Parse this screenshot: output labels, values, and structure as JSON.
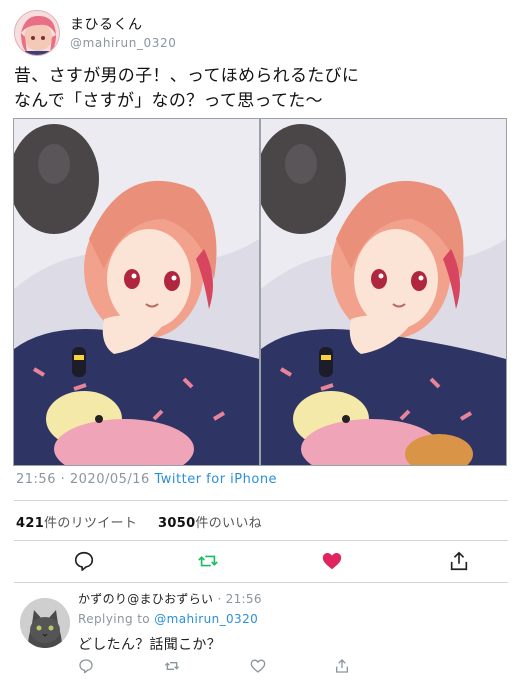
{
  "header": {
    "display_name": "まひるくん",
    "handle": "@mahirun_0320",
    "avatar_icon": "avatar-illustration"
  },
  "tweet": {
    "line1": "昔、さすが男の子！、ってほめられるたびに",
    "line2": "なんで「さすが」なの？って思ってた〜"
  },
  "images": [
    {
      "name": "illustration-1"
    },
    {
      "name": "illustration-2"
    }
  ],
  "meta": {
    "time": "21:56",
    "separator": "·",
    "date": "2020/05/16",
    "source": "Twitter for iPhone"
  },
  "stats": {
    "retweet_count": "421",
    "retweet_label": "件のリツイート",
    "like_count": "3050",
    "like_label": "件のいいね"
  },
  "actions": {
    "reply_icon": "reply-icon",
    "retweet_icon": "retweet-icon",
    "like_icon": "heart-icon",
    "share_icon": "share-icon",
    "like_color": "#e0245e",
    "retweet_color": "#17bf63"
  },
  "reply": {
    "author": "かずのり@まひおずらい",
    "time": "· 21:56",
    "replying_label": "Replying to",
    "replying_handle": "@mahirun_0320",
    "text": "どしたん？話聞こか？"
  },
  "colors": {
    "link_blue": "#2a8fdc",
    "muted_gray": "#8a96a0"
  }
}
